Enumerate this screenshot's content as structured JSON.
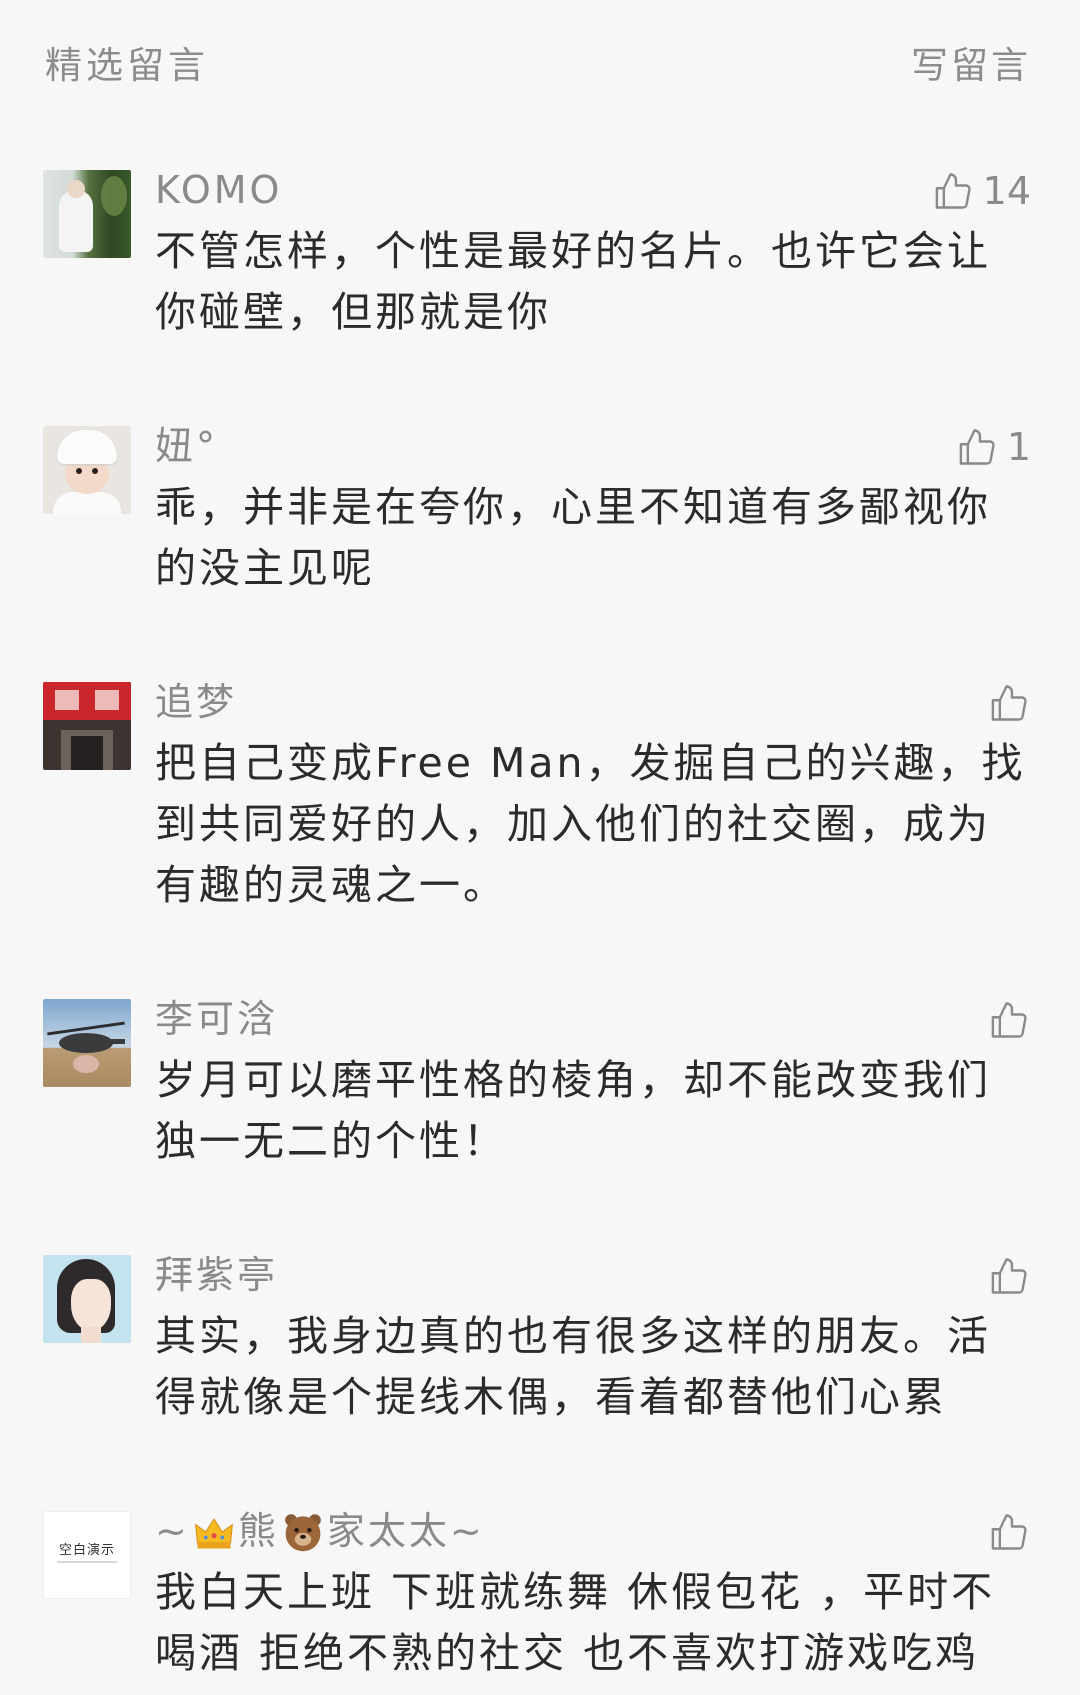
{
  "header": {
    "title": "精选留言",
    "write_label": "写留言"
  },
  "comments": [
    {
      "name": "KOMO",
      "likes": "14",
      "lines": [
        "不管怎样，个性是最好的名片。也许它会让",
        "你碰壁，但那就是你"
      ]
    },
    {
      "name": "妞°",
      "likes": "1",
      "lines": [
        "乖，并非是在夸你，心里不知道有多鄙视你",
        "的没主见呢"
      ]
    },
    {
      "name": "追梦",
      "likes": "",
      "lines": [
        "把自己变成Free Man，发掘自己的兴趣，找",
        "到共同爱好的人，加入他们的社交圈，成为",
        "有趣的灵魂之一。"
      ]
    },
    {
      "name": "李可浛",
      "likes": "",
      "lines": [
        "岁月可以磨平性格的棱角，却不能改变我们",
        "独一无二的个性！"
      ]
    },
    {
      "name": "拜紫亭",
      "likes": "",
      "lines": [
        "其实，我身边真的也有很多这样的朋友。活",
        "得就像是个提线木偶，看着都替他们心累"
      ]
    },
    {
      "name_segments": [
        {
          "text": "~"
        },
        {
          "icon": "crown-emoji"
        },
        {
          "text": "熊"
        },
        {
          "icon": "bear-emoji"
        },
        {
          "text": "家太太~"
        }
      ],
      "likes": "",
      "avatar_text": "空白演示",
      "lines": [
        "我白天上班 下班就练舞 休假包花 ，平时不",
        "喝酒 拒绝不熟的社交 也不喜欢打游戏吃鸡"
      ]
    }
  ],
  "colors": {
    "background": "#f7f7f7",
    "secondary_text": "#8a8a8a",
    "body_text": "#2b2b2b"
  },
  "icons": {
    "like": "thumbs-up-icon"
  }
}
